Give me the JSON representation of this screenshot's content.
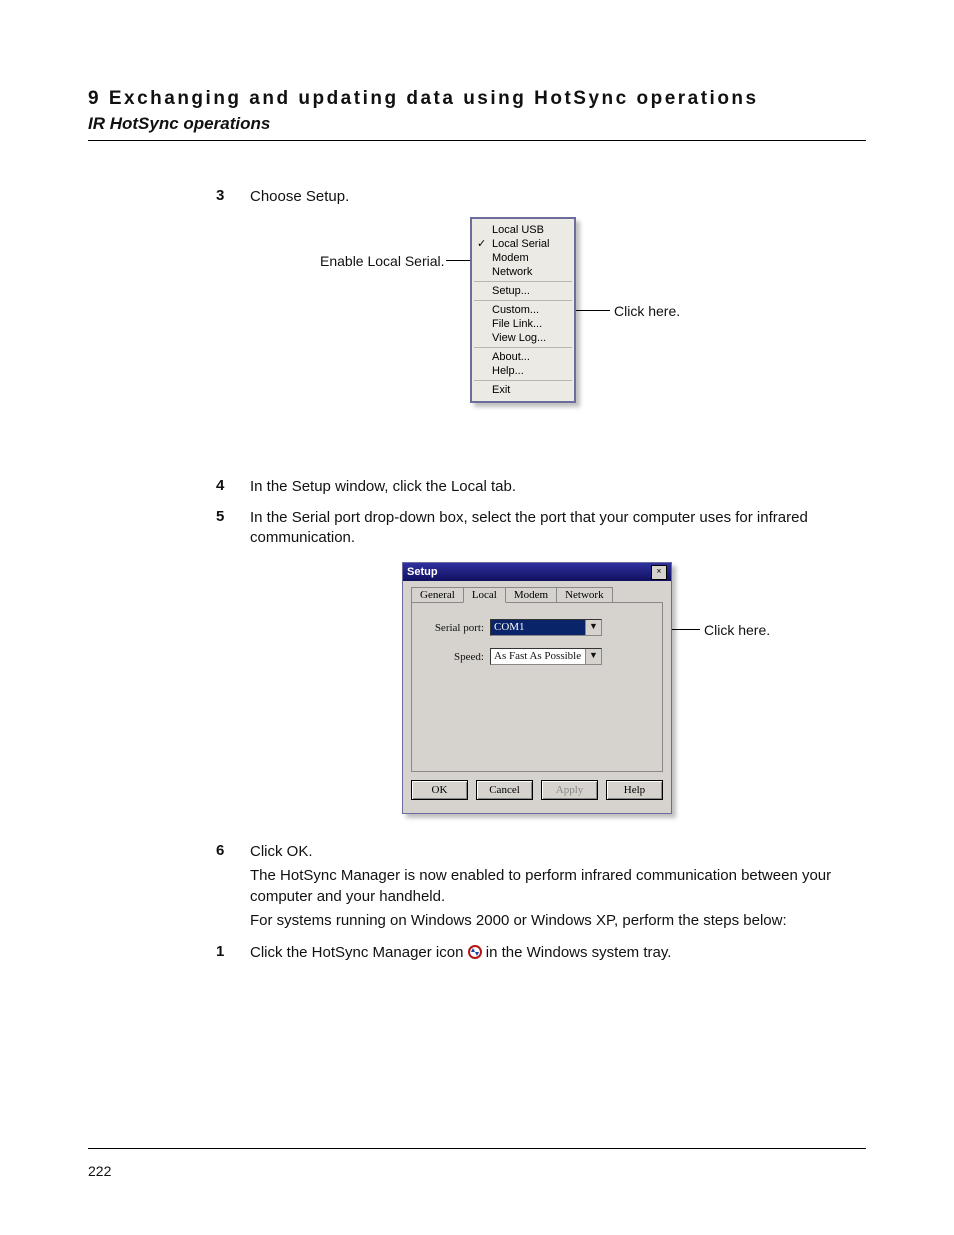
{
  "header": {
    "chapter": "9 Exchanging and updating data using HotSync operations",
    "section": "IR HotSync operations"
  },
  "steps_a": [
    {
      "n": "3",
      "text": "Choose Setup."
    },
    {
      "n": "4",
      "text": "In the Setup window, click the Local tab."
    },
    {
      "n": "5",
      "text": "In the Serial port drop-down box, select the port that your computer uses for infrared communication."
    }
  ],
  "steps_b": {
    "n": "6",
    "lead": "Click OK.",
    "p1": "The HotSync Manager is now enabled to perform infrared communication between your computer and your handheld.",
    "p2": "For systems running on Windows 2000 or Windows XP, perform the steps below:"
  },
  "steps_c": {
    "n": "1",
    "pre": "Click the HotSync Manager icon ",
    "post": " in the Windows system tray."
  },
  "annotations": {
    "enable_local_serial": "Enable Local Serial.",
    "click_here": "Click here.",
    "click_here_2": "Click here."
  },
  "context_menu": {
    "group1": [
      "Local USB",
      "Local Serial",
      "Modem",
      "Network"
    ],
    "checked_index": 1,
    "group2": [
      "Setup..."
    ],
    "group3": [
      "Custom...",
      "File Link...",
      "View Log..."
    ],
    "group4": [
      "About...",
      "Help..."
    ],
    "group5": [
      "Exit"
    ]
  },
  "setup_dialog": {
    "title": "Setup",
    "tabs": [
      "General",
      "Local",
      "Modem",
      "Network"
    ],
    "active_tab_index": 1,
    "fields": {
      "serial_port_label": "Serial port:",
      "serial_port_value": "COM1",
      "speed_label": "Speed:",
      "speed_value": "As Fast As Possible"
    },
    "buttons": {
      "ok": "OK",
      "cancel": "Cancel",
      "apply": "Apply",
      "help": "Help"
    }
  },
  "footer": {
    "page": "222"
  }
}
